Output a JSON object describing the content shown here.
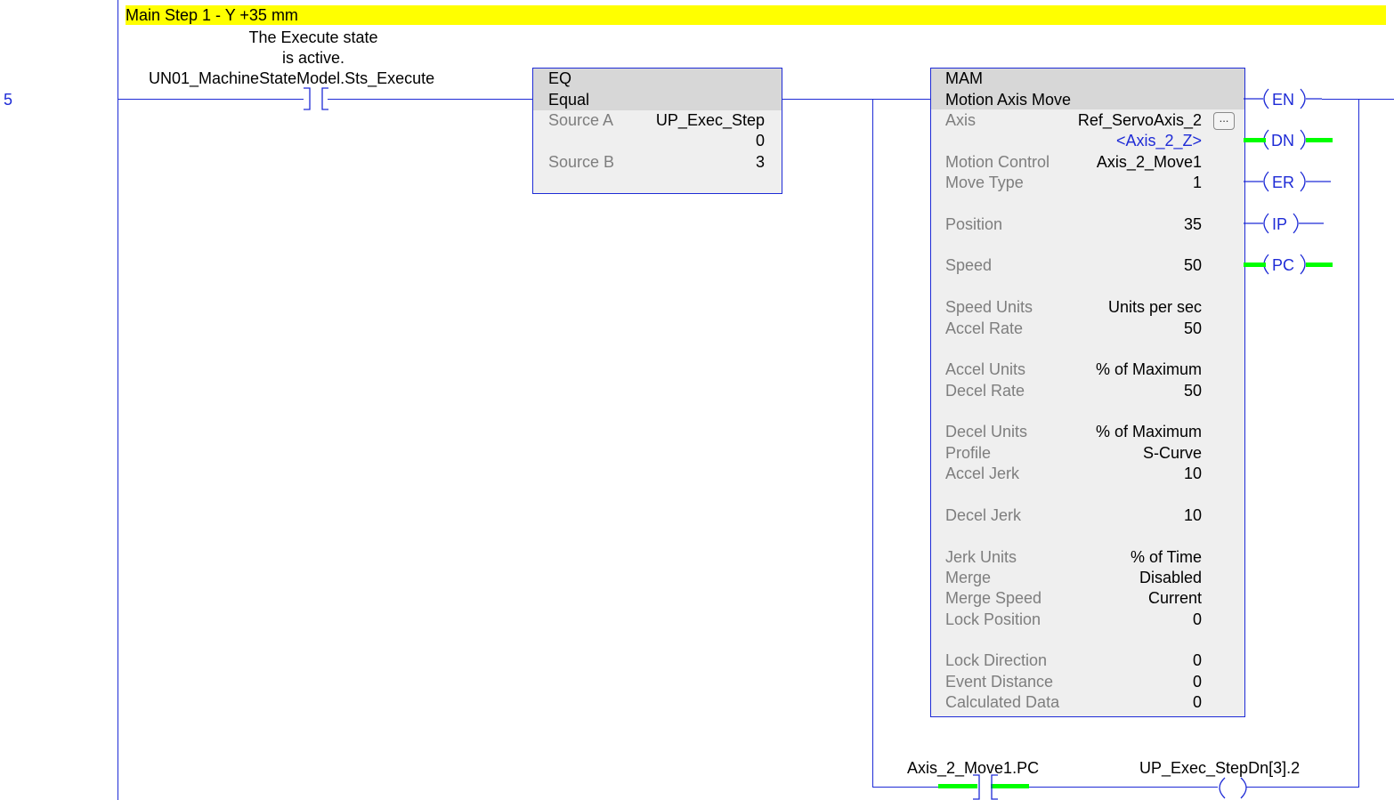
{
  "rung": {
    "number": "5",
    "comment": "Main Step 1 - Y +35 mm"
  },
  "xic": {
    "description_line1": "The Execute state",
    "description_line2": "is active.",
    "tag": "UN01_MachineStateModel.Sts_Execute"
  },
  "eq": {
    "mnemonic": "EQ",
    "name": "Equal",
    "source_a_label": "Source A",
    "source_a_tag": "UP_Exec_Step",
    "source_a_value": "0",
    "source_b_label": "Source B",
    "source_b_value": "3"
  },
  "mam": {
    "mnemonic": "MAM",
    "name": "Motion Axis Move",
    "axis_label": "Axis",
    "axis_value": "Ref_ServoAxis_2",
    "axis_alias": "<Axis_2_Z>",
    "ellipsis": "...",
    "params": [
      {
        "label": "Motion Control",
        "value": "Axis_2_Move1"
      },
      {
        "label": "Move Type",
        "value": "1"
      },
      {
        "label": "Position",
        "value": "35"
      },
      {
        "label": "Speed",
        "value": "50"
      },
      {
        "label": "Speed Units",
        "value": "Units per sec"
      },
      {
        "label": "Accel Rate",
        "value": "50"
      },
      {
        "label": "Accel Units",
        "value": "% of Maximum"
      },
      {
        "label": "Decel Rate",
        "value": "50"
      },
      {
        "label": "Decel Units",
        "value": "% of Maximum"
      },
      {
        "label": "Profile",
        "value": "S-Curve"
      },
      {
        "label": "Accel Jerk",
        "value": "10"
      },
      {
        "label": "Decel Jerk",
        "value": "10"
      },
      {
        "label": "Jerk Units",
        "value": "% of Time"
      },
      {
        "label": "Merge",
        "value": "Disabled"
      },
      {
        "label": "Merge Speed",
        "value": "Current"
      },
      {
        "label": "Lock Position",
        "value": "0"
      },
      {
        "label": "Lock Direction",
        "value": "0"
      },
      {
        "label": "Event Distance",
        "value": "0"
      },
      {
        "label": "Calculated Data",
        "value": "0"
      }
    ],
    "outputs": [
      "EN",
      "DN",
      "ER",
      "IP",
      "PC"
    ]
  },
  "branch": {
    "contact_tag": "Axis_2_Move1.PC",
    "coil_tag": "UP_Exec_StepDn[3].2"
  },
  "colors": {
    "wire": "#1e2bd6",
    "energized": "#00ff00",
    "comment_bg": "#ffff00",
    "box_bg": "#efefef",
    "box_header": "#d7d7d7"
  }
}
